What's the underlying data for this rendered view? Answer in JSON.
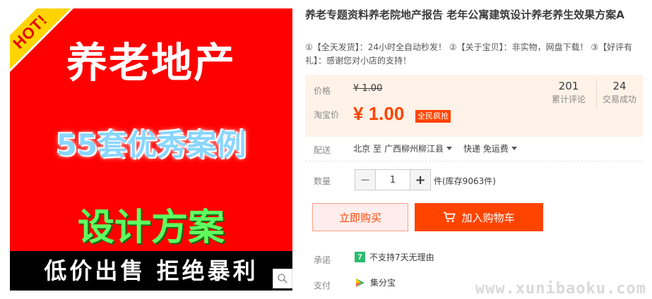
{
  "product_image": {
    "hot_tag": "HOT!",
    "headline": "养老地产",
    "subheadline": "55套优秀案例",
    "plan_text": "设计方案",
    "footer_text": "低价出售 拒绝暴利",
    "background_color": "#ff0000"
  },
  "title": "养老专题资料养老院地产报告 老年公寓建筑设计养老养生效果方案A",
  "description": "①【全天发货】：24小时全自动秒发！ ②【关于宝贝】：非实物，网盘下载！ ③【好评有礼】：感谢您对小店的支持！",
  "price_panel": {
    "price_label": "价格",
    "original_price": "¥ 1.00",
    "taobao_price_label": "淘宝价",
    "promo_price": "¥ 1.00",
    "promo_badge": "全民疯抢",
    "reviews_count": "201",
    "reviews_label": "累计评论",
    "trades_count": "24",
    "trades_label": "交易成功"
  },
  "shipping": {
    "label": "配送",
    "from": "北京",
    "to_word": "至",
    "destination": "广西柳州柳江县",
    "method": "快递 免运费"
  },
  "quantity": {
    "label": "数量",
    "minus": "−",
    "value": "1",
    "plus": "+",
    "stock_text": "件(库存9063件)"
  },
  "actions": {
    "buy_now": "立即购买",
    "add_to_cart": "加入购物车"
  },
  "promise": {
    "label": "承诺",
    "icon_text": "7",
    "text": "不支持7天无理由"
  },
  "payment": {
    "label": "支付",
    "method": "集分宝"
  },
  "watermark": "www.xunibaoku.com",
  "colors": {
    "accent": "#ff4400",
    "price_panel_bg": "#fff2e8",
    "promise_icon": "#2dbb6f"
  }
}
